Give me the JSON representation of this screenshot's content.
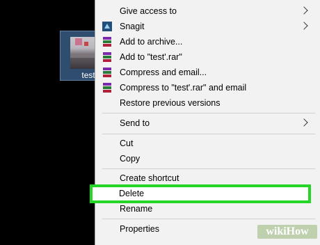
{
  "desktop": {
    "file_label": "test'"
  },
  "menu": {
    "items": [
      {
        "label": "Give access to",
        "icon": "none",
        "submenu": true
      },
      {
        "label": "Snagit",
        "icon": "snagit-icon",
        "submenu": true
      },
      {
        "label": "Add to archive...",
        "icon": "winrar-icon",
        "submenu": false
      },
      {
        "label": "Add to \"test'.rar\"",
        "icon": "winrar-icon",
        "submenu": false
      },
      {
        "label": "Compress and email...",
        "icon": "winrar-icon",
        "submenu": false
      },
      {
        "label": "Compress to \"test'.rar\" and email",
        "icon": "winrar-icon",
        "submenu": false
      },
      {
        "label": "Restore previous versions",
        "icon": "none",
        "submenu": false
      },
      {
        "label": "Send to",
        "icon": "none",
        "submenu": true
      },
      {
        "label": "Cut",
        "icon": "none",
        "submenu": false
      },
      {
        "label": "Copy",
        "icon": "none",
        "submenu": false
      },
      {
        "label": "Create shortcut",
        "icon": "none",
        "submenu": false
      },
      {
        "label": "Delete",
        "icon": "none",
        "submenu": false,
        "highlighted": true
      },
      {
        "label": "Rename",
        "icon": "none",
        "submenu": false
      },
      {
        "label": "Properties",
        "icon": "none",
        "submenu": false
      }
    ]
  },
  "watermark": {
    "text": "wikiHow"
  },
  "colors": {
    "highlight_border": "#24d626",
    "menu_background": "#f2f2f2",
    "desktop_background": "#000000"
  }
}
